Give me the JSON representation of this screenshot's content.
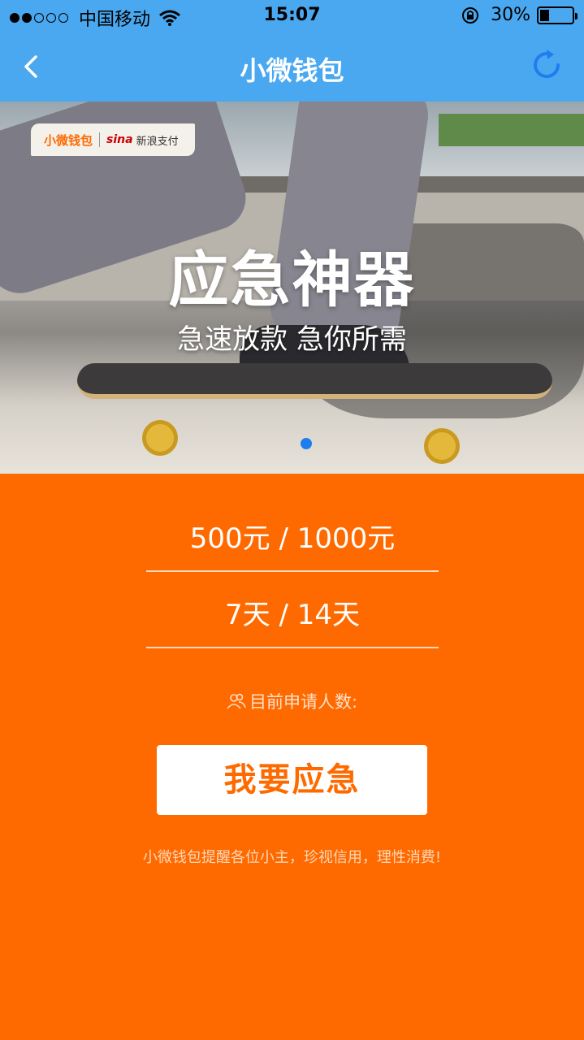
{
  "status_bar": {
    "carrier": "中国移动",
    "time": "15:07",
    "battery_text": "30%",
    "battery_level": 0.3,
    "signal_strength": 2
  },
  "nav": {
    "title": "小微钱包",
    "back_icon": "chevron-left-icon",
    "refresh_icon": "refresh-icon",
    "accent": "#4aa8f0"
  },
  "banner": {
    "logo_brand": "小微钱包",
    "logo_partner_mark": "sina",
    "logo_partner_name": "新浪支付",
    "title": "应急神器",
    "subtitle": "急速放款 急你所需",
    "active_slide": 1,
    "slide_count": 1
  },
  "main": {
    "amount_options": "500元 / 1000元",
    "term_options": "7天 / 14天",
    "applicants_label": "目前申请人数:",
    "applicants_icon": "users-icon",
    "apply_button": "我要应急",
    "footer_note": "小微钱包提醒各位小主，珍视信用，理性消费!",
    "background_color": "#ff6a00"
  }
}
